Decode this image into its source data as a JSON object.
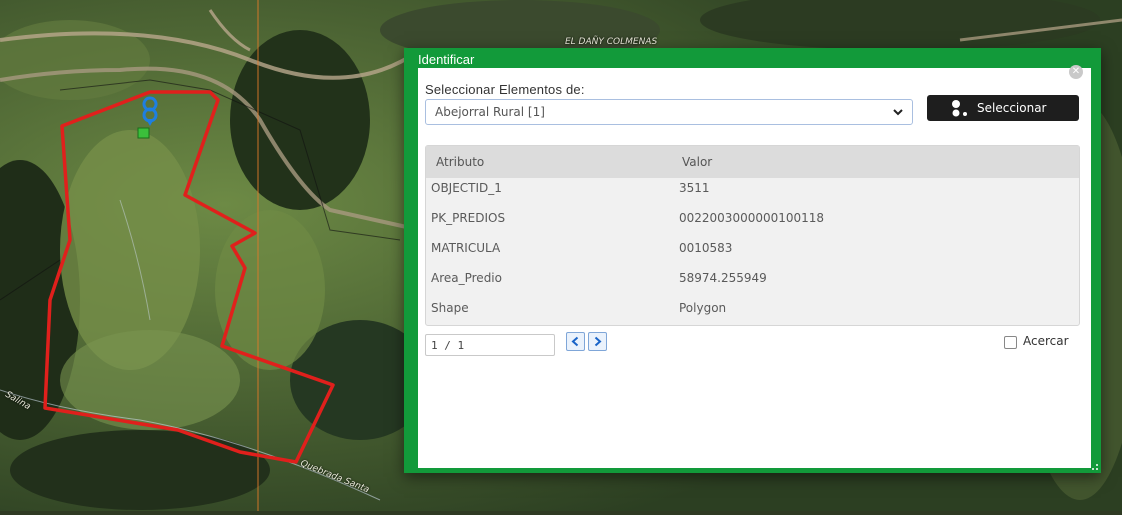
{
  "map": {
    "labels": {
      "road_top": "EL DAÑY COLMENAS",
      "stream": "Quebrada Santa",
      "left_edge": "Salina"
    }
  },
  "dialog": {
    "title": "Identificar",
    "select_label": "Seleccionar Elementos de:",
    "selected_layer": "Abejorral Rural [1]",
    "select_button": "Seleccionar",
    "table": {
      "headers": [
        "Atributo",
        "Valor"
      ],
      "rows": [
        {
          "attr": "OBJECTID_1",
          "value": "3511"
        },
        {
          "attr": "PK_PREDIOS",
          "value": "0022003000000100118"
        },
        {
          "attr": "MATRICULA",
          "value": "0010583"
        },
        {
          "attr": "Area_Predio",
          "value": "58974.255949"
        },
        {
          "attr": "Shape",
          "value": "Polygon"
        }
      ]
    },
    "pager_value": "1 / 1",
    "zoom_label": "Acercar",
    "zoom_checked": false
  },
  "colors": {
    "accent": "#129a3a",
    "parcel_outline": "#e0201c",
    "marker": "#1e7fe0"
  },
  "icons": [
    "close-icon",
    "chevron-down-icon",
    "select-features-icon",
    "chevron-left-icon",
    "chevron-right-icon",
    "location-pin-icon"
  ]
}
